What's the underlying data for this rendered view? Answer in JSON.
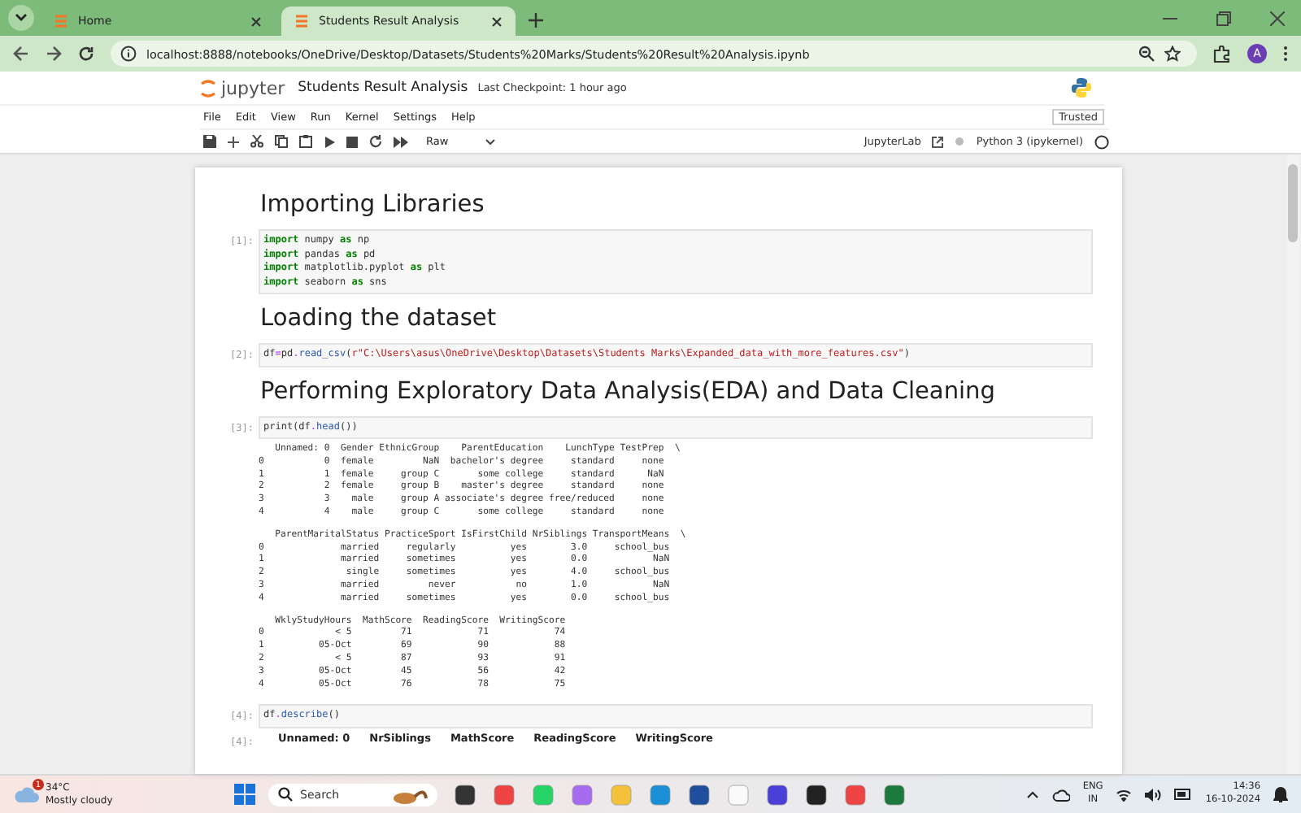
{
  "browser": {
    "tabs": [
      {
        "title": "Home",
        "selected": false
      },
      {
        "title": "Students Result Analysis",
        "selected": true
      }
    ],
    "url": "localhost:8888/notebooks/OneDrive/Desktop/Datasets/Students%20Marks/Students%20Result%20Analysis.ipynb",
    "profile": "A"
  },
  "jupyter": {
    "logo": "jupyter",
    "title": "Students Result Analysis",
    "checkpoint": "Last Checkpoint: 1 hour ago",
    "trusted": "Trusted",
    "menu": [
      "File",
      "Edit",
      "View",
      "Run",
      "Kernel",
      "Settings",
      "Help"
    ],
    "cell_type": "Raw",
    "jupyterlab": "JupyterLab",
    "kernel": "Python 3 (ipykernel)"
  },
  "cells": [
    {
      "kind": "markdown",
      "text": "Importing Libraries"
    },
    {
      "kind": "code",
      "prompt": "[1]:",
      "lines": [
        [
          {
            "kind": "keyword",
            "text": "import"
          },
          {
            "kind": "name",
            "text": " numpy "
          },
          {
            "kind": "keyword",
            "text": "as"
          },
          {
            "kind": "name",
            "text": " np"
          }
        ],
        [
          {
            "kind": "keyword",
            "text": "import"
          },
          {
            "kind": "name",
            "text": " pandas "
          },
          {
            "kind": "keyword",
            "text": "as"
          },
          {
            "kind": "name",
            "text": " pd"
          }
        ],
        [
          {
            "kind": "keyword",
            "text": "import"
          },
          {
            "kind": "name",
            "text": " matplotlib.pyplot "
          },
          {
            "kind": "keyword",
            "text": "as"
          },
          {
            "kind": "name",
            "text": " plt"
          }
        ],
        [
          {
            "kind": "keyword",
            "text": "import"
          },
          {
            "kind": "name",
            "text": " seaborn "
          },
          {
            "kind": "keyword",
            "text": "as"
          },
          {
            "kind": "name",
            "text": " sns"
          }
        ]
      ]
    },
    {
      "kind": "markdown",
      "text": "Loading the dataset"
    },
    {
      "kind": "code",
      "prompt": "[2]:",
      "lines": [
        [
          {
            "kind": "name",
            "text": "df"
          },
          {
            "kind": "operator",
            "text": "="
          },
          {
            "kind": "name",
            "text": "pd"
          },
          {
            "kind": "operator",
            "text": "."
          },
          {
            "kind": "function",
            "text": "read_csv"
          },
          {
            "kind": "name",
            "text": "("
          },
          {
            "kind": "string",
            "text": "r\"C:\\Users\\asus\\OneDrive\\Desktop\\Datasets\\Students Marks\\Expanded_data_with_more_features.csv\""
          },
          {
            "kind": "name",
            "text": ")"
          }
        ]
      ]
    },
    {
      "kind": "markdown",
      "text": "Performing Exploratory Data Analysis(EDA) and Data Cleaning"
    },
    {
      "kind": "code",
      "prompt": "[3]:",
      "lines": [
        [
          {
            "kind": "name",
            "text": "print(df"
          },
          {
            "kind": "operator",
            "text": "."
          },
          {
            "kind": "function",
            "text": "head"
          },
          {
            "kind": "name",
            "text": "())"
          }
        ]
      ],
      "output": {
        "kind": "text",
        "blocks": [
          [
            "   Unnamed: 0  Gender EthnicGroup    ParentEducation    LunchType TestPrep  \\",
            "0           0  female         NaN  bachelor's degree     standard     none",
            "1           1  female     group C       some college     standard      NaN",
            "2           2  female     group B    master's degree     standard     none",
            "3           3    male     group A associate's degree free/reduced     none",
            "4           4    male     group C       some college     standard     none"
          ],
          [
            "   ParentMaritalStatus PracticeSport IsFirstChild NrSiblings TransportMeans  \\",
            "0              married     regularly          yes        3.0     school_bus",
            "1              married     sometimes          yes        0.0            NaN",
            "2               single     sometimes          yes        4.0     school_bus",
            "3              married         never           no        1.0            NaN",
            "4              married     sometimes          yes        0.0     school_bus"
          ],
          [
            "   WklyStudyHours  MathScore  ReadingScore  WritingScore",
            "0             < 5         71            71            74",
            "1          05-Oct         69            90            88",
            "2             < 5         87            93            91",
            "3          05-Oct         45            56            42",
            "4          05-Oct         76            78            75"
          ]
        ]
      }
    },
    {
      "kind": "code",
      "prompt": "[4]:",
      "lines": [
        [
          {
            "kind": "name",
            "text": "df"
          },
          {
            "kind": "operator",
            "text": "."
          },
          {
            "kind": "function",
            "text": "describe"
          },
          {
            "kind": "name",
            "text": "()"
          }
        ]
      ],
      "output": {
        "kind": "table",
        "prompt": "[4]:",
        "columns": [
          "Unnamed: 0",
          "NrSiblings",
          "MathScore",
          "ReadingScore",
          "WritingScore"
        ]
      }
    }
  ],
  "taskbar": {
    "weather": {
      "badge": "1",
      "temperature": "34°C",
      "condition": "Mostly cloudy"
    },
    "search": "Search",
    "language": "ENG",
    "region": "IN",
    "time": "14:36",
    "date": "16-10-2024"
  }
}
